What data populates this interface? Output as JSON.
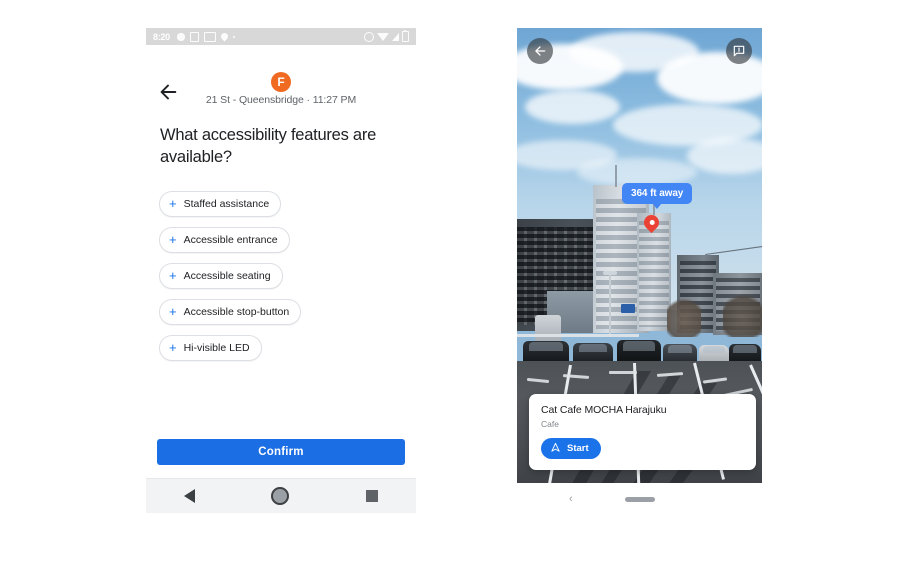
{
  "left_phone": {
    "statusbar": {
      "clock": "8:20",
      "left_icons": [
        "gear-icon",
        "square-icon",
        "image-icon",
        "location-pin-icon",
        "dot-icon"
      ],
      "right_icons": [
        "alarm-icon",
        "wifi-icon",
        "signal-icon",
        "battery-icon"
      ]
    },
    "header": {
      "back_icon": "back-arrow-icon",
      "line_badge": "F",
      "line_badge_color": "#f06a22",
      "station_time": "21 St - Queensbridge · 11:27 PM"
    },
    "question": "What accessibility features are available?",
    "chips": [
      {
        "plus": "+",
        "label": "Staffed assistance"
      },
      {
        "plus": "+",
        "label": "Accessible entrance"
      },
      {
        "plus": "+",
        "label": "Accessible seating"
      },
      {
        "plus": "+",
        "label": "Accessible stop-button"
      },
      {
        "plus": "+",
        "label": "Hi-visible LED"
      }
    ],
    "confirm_label": "Confirm",
    "confirm_color": "#1b6ee3",
    "navbar": {
      "back": "back-triangle-icon",
      "home": "home-circle-icon",
      "recents": "recents-square-icon"
    }
  },
  "right_phone": {
    "top_controls": {
      "back_icon": "back-arrow-icon",
      "feedback_icon": "feedback-message-icon"
    },
    "ar": {
      "distance_badge": "364 ft away",
      "badge_color": "#4285f4",
      "pin_icon": "map-pin-icon",
      "pin_color": "#ea4335"
    },
    "place_card": {
      "name": "Cat Cafe MOCHA Harajuku",
      "category": "Cafe",
      "start_label": "Start",
      "start_icon": "navigation-arrow-icon",
      "start_color": "#1a73e8"
    },
    "gesture_bar": {
      "back_chevron": "‹",
      "handle": "gesture-pill-handle"
    }
  }
}
